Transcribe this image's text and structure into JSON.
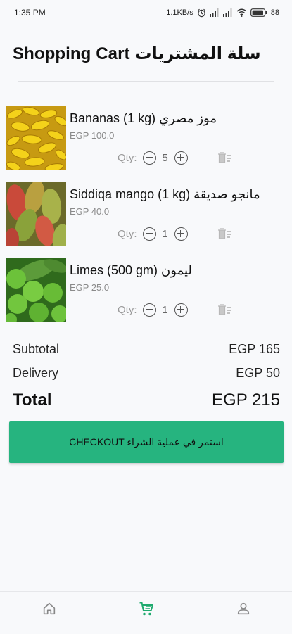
{
  "status_bar": {
    "time": "1:35 PM",
    "network_speed": "1.1KB/s",
    "battery": "88",
    "icons": [
      "alarm-icon",
      "signal-icon",
      "signal-icon",
      "wifi-icon",
      "battery-icon"
    ]
  },
  "header": {
    "title": "Shopping Cart سلة المشتريات"
  },
  "cart": {
    "qty_label": "Qty:",
    "items": [
      {
        "name": "Bananas (1 kg) موز مصري",
        "price": "EGP 100.0",
        "qty": "5",
        "image": "bananas"
      },
      {
        "name": "Siddiqa mango (1 kg) مانجو صديقة",
        "price": "EGP 40.0",
        "qty": "1",
        "image": "mangoes"
      },
      {
        "name": "Limes (500 gm) ليمون",
        "price": "EGP 25.0",
        "qty": "1",
        "image": "limes"
      }
    ]
  },
  "summary": {
    "subtotal_label": "Subtotal",
    "subtotal_value": "EGP 165",
    "delivery_label": "Delivery",
    "delivery_value": "EGP 50",
    "total_label": "Total",
    "total_value": "EGP 215"
  },
  "checkout": {
    "label": "CHECKOUT استمر في عملية الشراء"
  },
  "bottom_nav": {
    "items": [
      "home-icon",
      "cart-icon",
      "profile-icon"
    ],
    "active": "cart-icon"
  },
  "colors": {
    "accent": "#26b47f",
    "nav_active": "#1faa6e",
    "nav_inactive": "#888888",
    "background": "#f8f9fb"
  }
}
